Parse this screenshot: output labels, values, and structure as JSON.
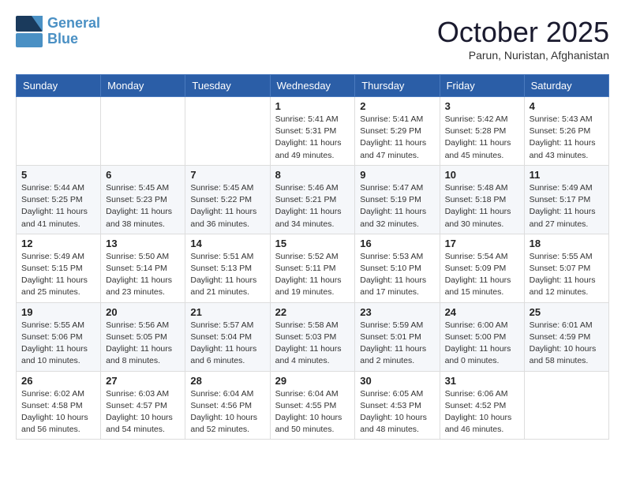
{
  "header": {
    "logo_line1": "General",
    "logo_line2": "Blue",
    "month": "October 2025",
    "location": "Parun, Nuristan, Afghanistan"
  },
  "weekdays": [
    "Sunday",
    "Monday",
    "Tuesday",
    "Wednesday",
    "Thursday",
    "Friday",
    "Saturday"
  ],
  "weeks": [
    [
      {
        "day": "",
        "info": ""
      },
      {
        "day": "",
        "info": ""
      },
      {
        "day": "",
        "info": ""
      },
      {
        "day": "1",
        "info": "Sunrise: 5:41 AM\nSunset: 5:31 PM\nDaylight: 11 hours\nand 49 minutes."
      },
      {
        "day": "2",
        "info": "Sunrise: 5:41 AM\nSunset: 5:29 PM\nDaylight: 11 hours\nand 47 minutes."
      },
      {
        "day": "3",
        "info": "Sunrise: 5:42 AM\nSunset: 5:28 PM\nDaylight: 11 hours\nand 45 minutes."
      },
      {
        "day": "4",
        "info": "Sunrise: 5:43 AM\nSunset: 5:26 PM\nDaylight: 11 hours\nand 43 minutes."
      }
    ],
    [
      {
        "day": "5",
        "info": "Sunrise: 5:44 AM\nSunset: 5:25 PM\nDaylight: 11 hours\nand 41 minutes."
      },
      {
        "day": "6",
        "info": "Sunrise: 5:45 AM\nSunset: 5:23 PM\nDaylight: 11 hours\nand 38 minutes."
      },
      {
        "day": "7",
        "info": "Sunrise: 5:45 AM\nSunset: 5:22 PM\nDaylight: 11 hours\nand 36 minutes."
      },
      {
        "day": "8",
        "info": "Sunrise: 5:46 AM\nSunset: 5:21 PM\nDaylight: 11 hours\nand 34 minutes."
      },
      {
        "day": "9",
        "info": "Sunrise: 5:47 AM\nSunset: 5:19 PM\nDaylight: 11 hours\nand 32 minutes."
      },
      {
        "day": "10",
        "info": "Sunrise: 5:48 AM\nSunset: 5:18 PM\nDaylight: 11 hours\nand 30 minutes."
      },
      {
        "day": "11",
        "info": "Sunrise: 5:49 AM\nSunset: 5:17 PM\nDaylight: 11 hours\nand 27 minutes."
      }
    ],
    [
      {
        "day": "12",
        "info": "Sunrise: 5:49 AM\nSunset: 5:15 PM\nDaylight: 11 hours\nand 25 minutes."
      },
      {
        "day": "13",
        "info": "Sunrise: 5:50 AM\nSunset: 5:14 PM\nDaylight: 11 hours\nand 23 minutes."
      },
      {
        "day": "14",
        "info": "Sunrise: 5:51 AM\nSunset: 5:13 PM\nDaylight: 11 hours\nand 21 minutes."
      },
      {
        "day": "15",
        "info": "Sunrise: 5:52 AM\nSunset: 5:11 PM\nDaylight: 11 hours\nand 19 minutes."
      },
      {
        "day": "16",
        "info": "Sunrise: 5:53 AM\nSunset: 5:10 PM\nDaylight: 11 hours\nand 17 minutes."
      },
      {
        "day": "17",
        "info": "Sunrise: 5:54 AM\nSunset: 5:09 PM\nDaylight: 11 hours\nand 15 minutes."
      },
      {
        "day": "18",
        "info": "Sunrise: 5:55 AM\nSunset: 5:07 PM\nDaylight: 11 hours\nand 12 minutes."
      }
    ],
    [
      {
        "day": "19",
        "info": "Sunrise: 5:55 AM\nSunset: 5:06 PM\nDaylight: 11 hours\nand 10 minutes."
      },
      {
        "day": "20",
        "info": "Sunrise: 5:56 AM\nSunset: 5:05 PM\nDaylight: 11 hours\nand 8 minutes."
      },
      {
        "day": "21",
        "info": "Sunrise: 5:57 AM\nSunset: 5:04 PM\nDaylight: 11 hours\nand 6 minutes."
      },
      {
        "day": "22",
        "info": "Sunrise: 5:58 AM\nSunset: 5:03 PM\nDaylight: 11 hours\nand 4 minutes."
      },
      {
        "day": "23",
        "info": "Sunrise: 5:59 AM\nSunset: 5:01 PM\nDaylight: 11 hours\nand 2 minutes."
      },
      {
        "day": "24",
        "info": "Sunrise: 6:00 AM\nSunset: 5:00 PM\nDaylight: 11 hours\nand 0 minutes."
      },
      {
        "day": "25",
        "info": "Sunrise: 6:01 AM\nSunset: 4:59 PM\nDaylight: 10 hours\nand 58 minutes."
      }
    ],
    [
      {
        "day": "26",
        "info": "Sunrise: 6:02 AM\nSunset: 4:58 PM\nDaylight: 10 hours\nand 56 minutes."
      },
      {
        "day": "27",
        "info": "Sunrise: 6:03 AM\nSunset: 4:57 PM\nDaylight: 10 hours\nand 54 minutes."
      },
      {
        "day": "28",
        "info": "Sunrise: 6:04 AM\nSunset: 4:56 PM\nDaylight: 10 hours\nand 52 minutes."
      },
      {
        "day": "29",
        "info": "Sunrise: 6:04 AM\nSunset: 4:55 PM\nDaylight: 10 hours\nand 50 minutes."
      },
      {
        "day": "30",
        "info": "Sunrise: 6:05 AM\nSunset: 4:53 PM\nDaylight: 10 hours\nand 48 minutes."
      },
      {
        "day": "31",
        "info": "Sunrise: 6:06 AM\nSunset: 4:52 PM\nDaylight: 10 hours\nand 46 minutes."
      },
      {
        "day": "",
        "info": ""
      }
    ]
  ]
}
